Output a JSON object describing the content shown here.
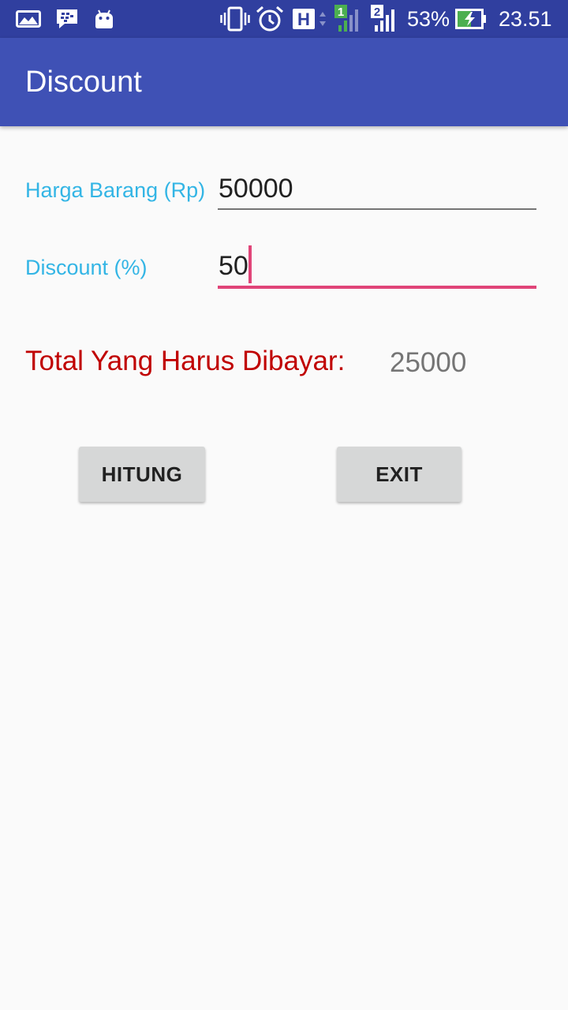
{
  "status_bar": {
    "icons": [
      "gallery-icon",
      "bbm-icon",
      "android-icon",
      "vibrate-icon",
      "alarm-icon",
      "hspa-icon",
      "signal-sim1-icon",
      "signal-sim2-icon",
      "battery-charging-icon"
    ],
    "network_type": "H",
    "sim1_label": "1",
    "sim2_label": "2",
    "battery_percent": "53%",
    "time": "23.51",
    "background_color": "#303f9f"
  },
  "app_bar": {
    "title": "Discount",
    "background_color": "#3f51b5"
  },
  "form": {
    "price": {
      "label": "Harga Barang (Rp)",
      "value": "50000"
    },
    "discount": {
      "label": "Discount (%)",
      "value": "50",
      "focused": true
    }
  },
  "result": {
    "label": "Total Yang Harus Dibayar:",
    "value": "25000"
  },
  "buttons": {
    "hitung_label": "HITUNG",
    "exit_label": "EXIT"
  },
  "colors": {
    "label": "#33b5e5",
    "accent": "#e04478",
    "total_label": "#c00000",
    "button_bg": "#d6d7d7"
  }
}
